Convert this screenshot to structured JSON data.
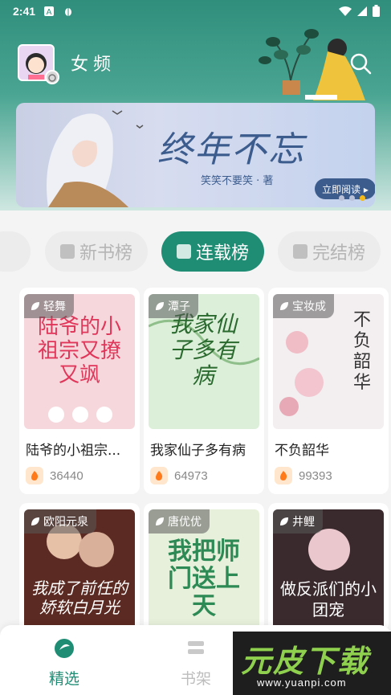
{
  "status_bar": {
    "time": "2:41",
    "icons": [
      "a-badge-icon",
      "bug-icon",
      "wifi-icon",
      "signal-icon",
      "battery-icon"
    ]
  },
  "header": {
    "channel_title": "女频",
    "search_icon": "search-icon"
  },
  "banner": {
    "title": "终年不忘",
    "author_line": "笑笑不要笑 · 著",
    "read_button": "立即阅读 ▸",
    "pager": {
      "count": 3,
      "active": 3
    }
  },
  "rank_tabs": [
    {
      "label": "新书榜",
      "active": false
    },
    {
      "label": "连载榜",
      "active": true
    },
    {
      "label": "完结榜",
      "active": false
    }
  ],
  "books": [
    {
      "author": "轻舞",
      "title": "陆爷的小祖宗...",
      "heat": "36440",
      "cover_text": "陆爷的小祖宗又撩又飒",
      "cover_color": "#f6d7dc"
    },
    {
      "author": "潭子",
      "title": "我家仙子多有病",
      "heat": "64973",
      "cover_text": "我家仙子多有病",
      "cover_color": "#dcefd9"
    },
    {
      "author": "宝妆成",
      "title": "不负韶华",
      "heat": "99393",
      "cover_text": "不负韶华",
      "cover_color": "#f3eef0"
    },
    {
      "author": "欧阳元泉",
      "title": "",
      "heat": "",
      "cover_text": "我成了前任的娇软白月光",
      "cover_color": "#5b2a22"
    },
    {
      "author": "唐优优",
      "title": "",
      "heat": "",
      "cover_text": "我把师门送上天",
      "cover_color": "#e6f0da"
    },
    {
      "author": "井鲤",
      "title": "",
      "heat": "",
      "cover_text": "做反派们的小团宠",
      "cover_color": "#3a2a2e"
    }
  ],
  "bottom_nav": [
    {
      "label": "精选",
      "active": true,
      "icon": "featured-icon"
    },
    {
      "label": "书架",
      "active": false,
      "icon": "bookshelf-icon"
    }
  ],
  "watermark": {
    "text": "元皮下载",
    "url": "www.yuanpi.com"
  },
  "colors": {
    "accent": "#1f8d74",
    "banner_text": "#3c5c8e",
    "dot_active": "#f6b915"
  }
}
